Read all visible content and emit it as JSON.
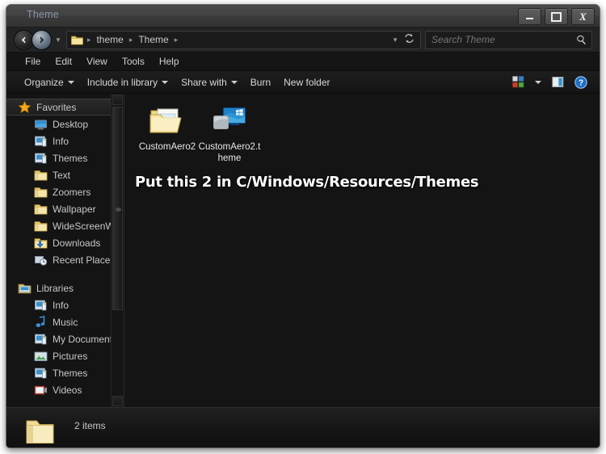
{
  "window": {
    "title": "Theme",
    "controls": {
      "minimize": "Minimize",
      "maximize": "Maximize",
      "close": "Close"
    }
  },
  "addressbar": {
    "back_tooltip": "Back",
    "forward_tooltip": "Forward",
    "recent_tooltip": "Recent pages",
    "crumbs": [
      "theme",
      "Theme"
    ],
    "separator": "▸",
    "refresh_tooltip": "Refresh"
  },
  "search": {
    "placeholder": "Search Theme",
    "value": ""
  },
  "menubar": {
    "items": [
      "File",
      "Edit",
      "View",
      "Tools",
      "Help"
    ]
  },
  "commandbar": {
    "items": [
      {
        "label": "Organize",
        "has_caret": true
      },
      {
        "label": "Include in library",
        "has_caret": true
      },
      {
        "label": "Share with",
        "has_caret": true
      },
      {
        "label": "Burn",
        "has_caret": false
      },
      {
        "label": "New folder",
        "has_caret": false
      }
    ],
    "view_tooltip": "Change your view",
    "view_caret_tooltip": "More options",
    "preview_tooltip": "Show the preview pane",
    "help_tooltip": "Get help"
  },
  "sidebar": {
    "sections": [
      {
        "header": {
          "label": "Favorites",
          "icon": "star-icon",
          "selected": true
        },
        "items": [
          {
            "label": "Desktop",
            "icon": "desktop-icon"
          },
          {
            "label": "Info",
            "icon": "library-icon"
          },
          {
            "label": "Themes",
            "icon": "library-icon"
          },
          {
            "label": "Text",
            "icon": "folder-icon"
          },
          {
            "label": "Zoomers",
            "icon": "folder-icon"
          },
          {
            "label": "Wallpaper",
            "icon": "folder-icon"
          },
          {
            "label": "WideScreenWal",
            "icon": "folder-icon"
          },
          {
            "label": "Downloads",
            "icon": "downloads-icon"
          },
          {
            "label": "Recent Places",
            "icon": "recent-places-icon"
          }
        ]
      },
      {
        "header": {
          "label": "Libraries",
          "icon": "libraries-icon",
          "selected": false
        },
        "items": [
          {
            "label": "Info",
            "icon": "library-icon"
          },
          {
            "label": "Music",
            "icon": "music-icon"
          },
          {
            "label": "My Documents",
            "icon": "library-icon"
          },
          {
            "label": "Pictures",
            "icon": "pictures-icon"
          },
          {
            "label": "Themes",
            "icon": "library-icon"
          },
          {
            "label": "Videos",
            "icon": "videos-icon"
          }
        ]
      }
    ],
    "scrollbar": {
      "up_arrow": "▲",
      "down_arrow": "▼"
    }
  },
  "content": {
    "files": [
      {
        "name": "CustomAero2",
        "icon": "folder-with-pictures-icon"
      },
      {
        "name": "CustomAero2.theme",
        "icon": "theme-file-icon"
      }
    ],
    "overlay_note": "Put this 2 in C/Windows/Resources/Themes"
  },
  "statusbar": {
    "item_count": "2 items",
    "icon": "folder-icon"
  },
  "colors": {
    "window_bg": "#141414",
    "titlebar": "#434343",
    "title_text": "#8b96a8",
    "text": "#d2d2d2",
    "folder_yellow": "#f2d98b",
    "star_orange": "#f0a21e",
    "accent_blue": "#2a7fd4",
    "overlay_white": "#ffffff"
  }
}
